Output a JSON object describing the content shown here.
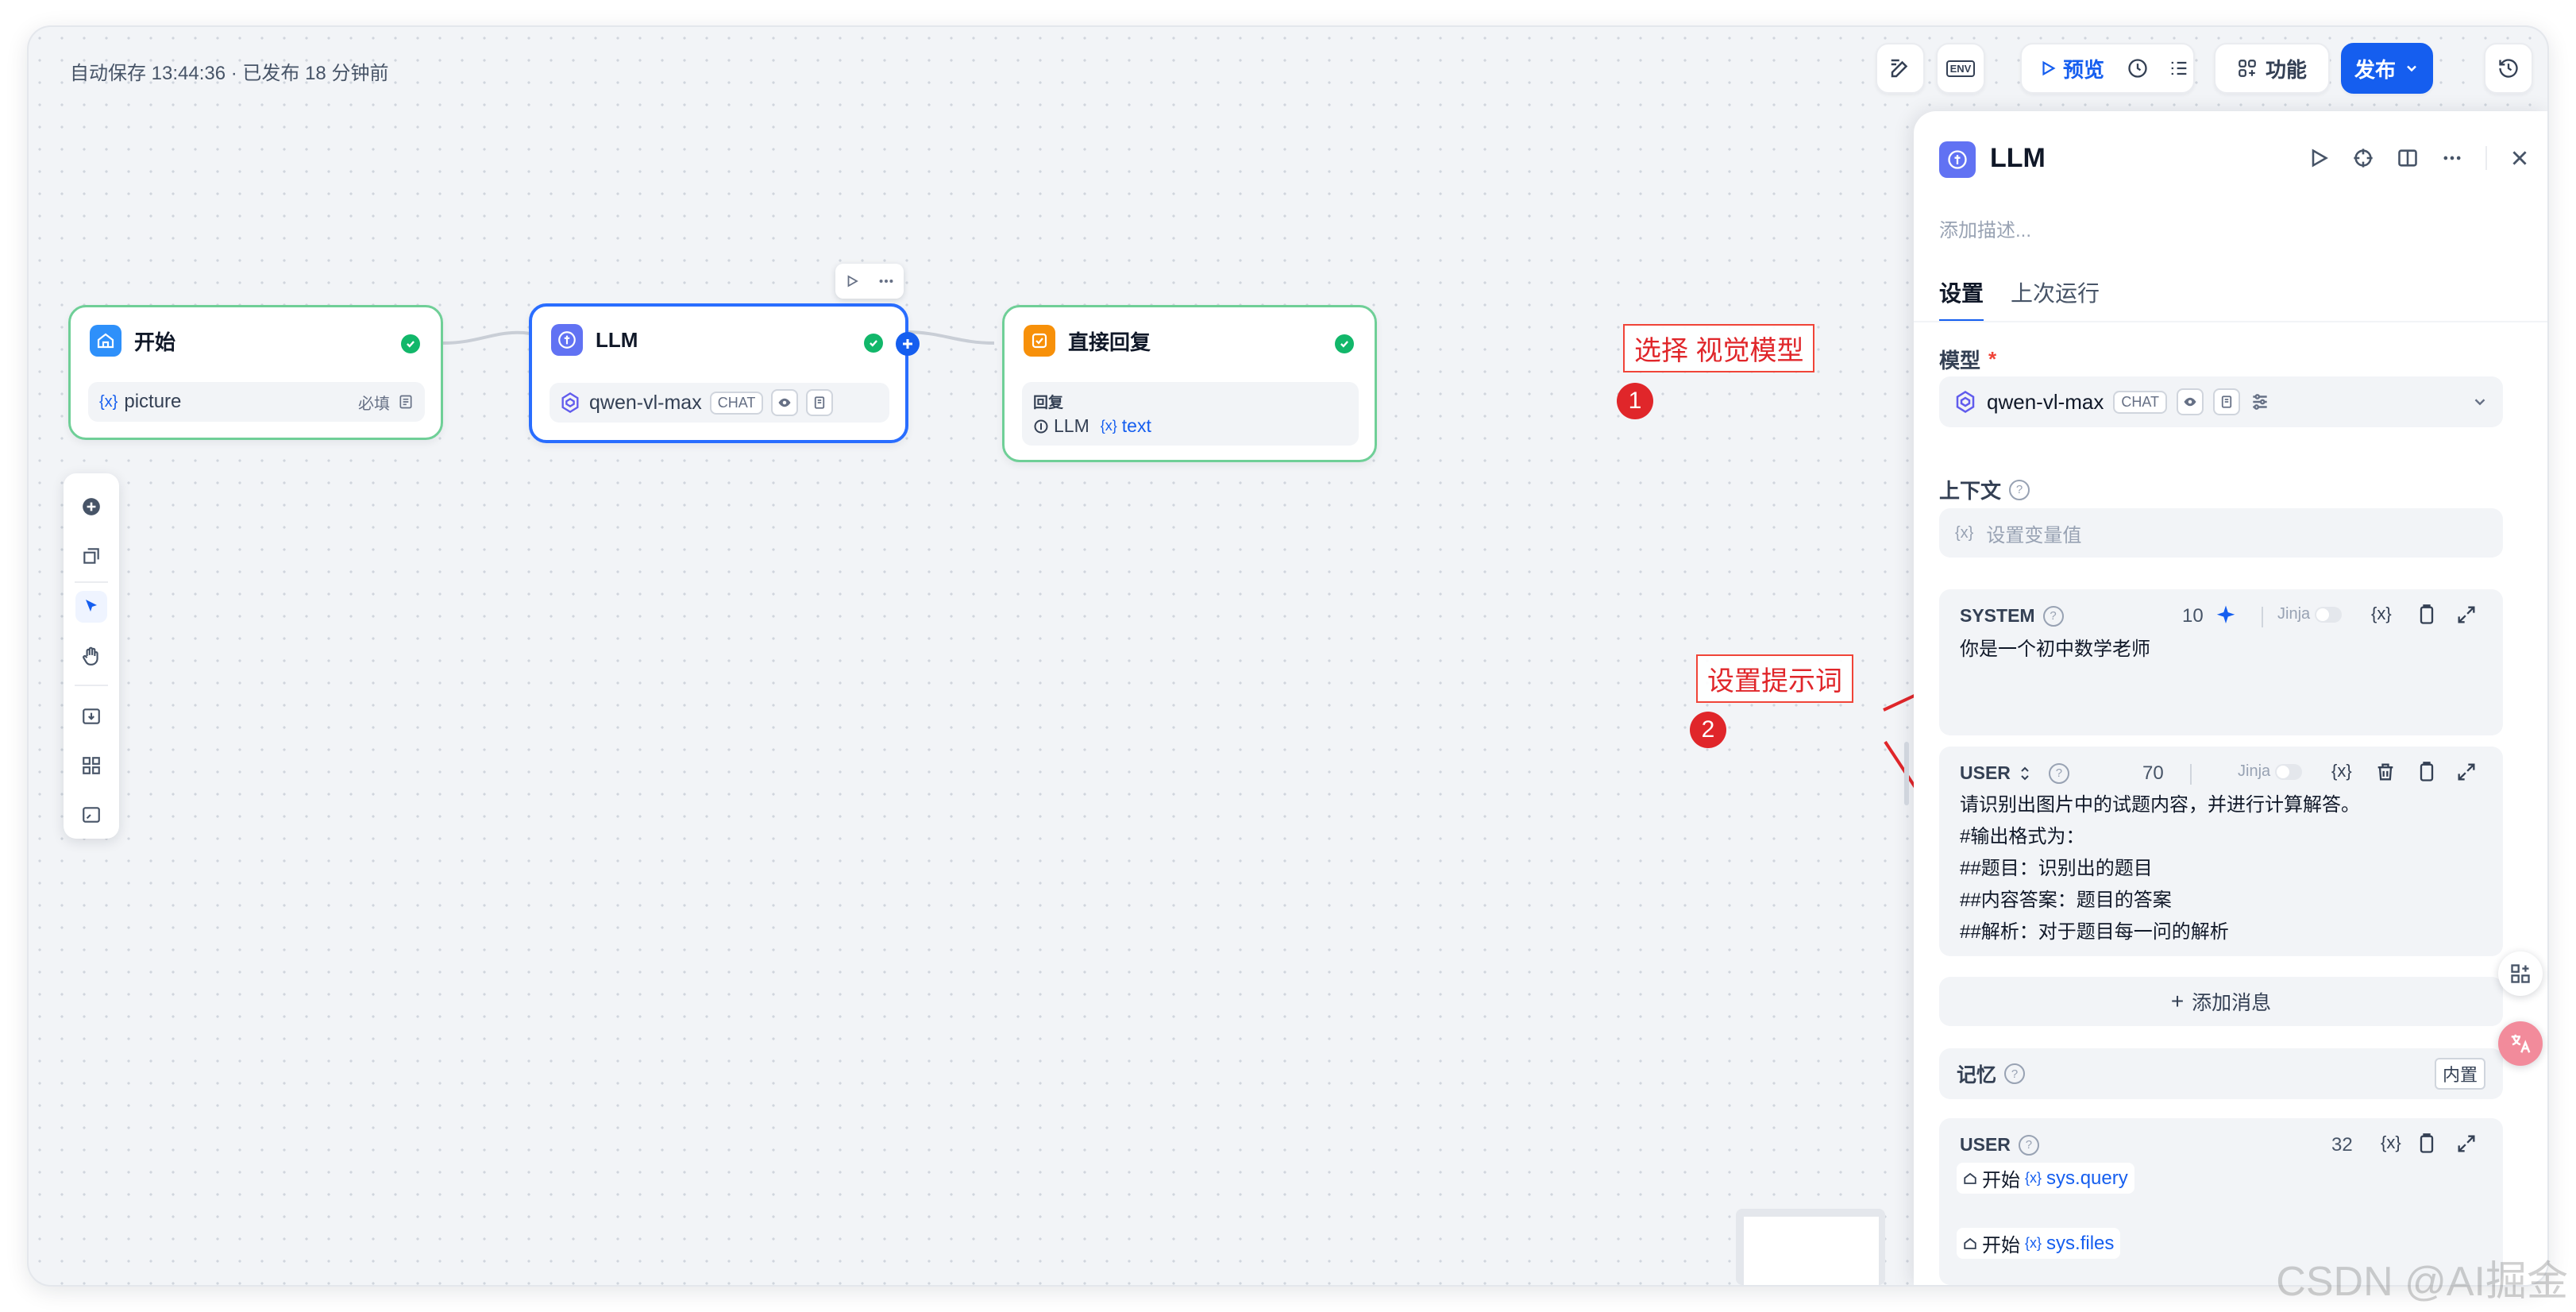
{
  "header": {
    "autosave": "自动保存 13:44:36 · 已发布 18 分钟前",
    "preview_label": "预览",
    "features_label": "功能",
    "publish_label": "发布",
    "env_label": "ENV"
  },
  "nodes": {
    "start": {
      "title": "开始",
      "var_name": "picture",
      "required": "必填"
    },
    "llm": {
      "title": "LLM",
      "model": "qwen-vl-max",
      "mode": "CHAT"
    },
    "reply": {
      "title": "直接回复",
      "label": "回复",
      "source_node": "LLM",
      "source_var": "text"
    }
  },
  "annotations": {
    "a1": {
      "text": "选择 视觉模型",
      "num": "1"
    },
    "a2": {
      "text": "设置提示词",
      "num": "2"
    }
  },
  "panel": {
    "title": "LLM",
    "desc_placeholder": "添加描述...",
    "tabs": [
      "设置",
      "上次运行"
    ],
    "model_label": "模型",
    "required_mark": "*",
    "model_name": "qwen-vl-max",
    "model_mode": "CHAT",
    "context_label": "上下文",
    "context_placeholder": "设置变量值",
    "system": {
      "role": "SYSTEM",
      "count": "10",
      "jinja": "Jinja",
      "text": "你是一个初中数学老师"
    },
    "user": {
      "role": "USER",
      "count": "70",
      "jinja": "Jinja",
      "lines": [
        "请识别出图片中的试题内容，并进行计算解答。",
        "#输出格式为：",
        "##题目：识别出的题目",
        "##内容答案：题目的答案",
        "##解析：对于题目每一问的解析"
      ]
    },
    "add_message": "添加消息",
    "memory_label": "记忆",
    "memory_badge": "内置",
    "memory_user": {
      "role": "USER",
      "count": "32",
      "ref1_node": "开始",
      "ref1_var": "sys.query",
      "ref2_node": "开始",
      "ref2_var": "sys.files"
    }
  },
  "watermark": "CSDN @AI掘金",
  "colors": {
    "accent": "#155eef",
    "success": "#12b76a",
    "node_border": "#6fcf97",
    "annotation_red": "#e0262a",
    "llm_icon": "#6172f3",
    "reply_icon": "#f79009",
    "start_icon": "#2e90fa"
  }
}
